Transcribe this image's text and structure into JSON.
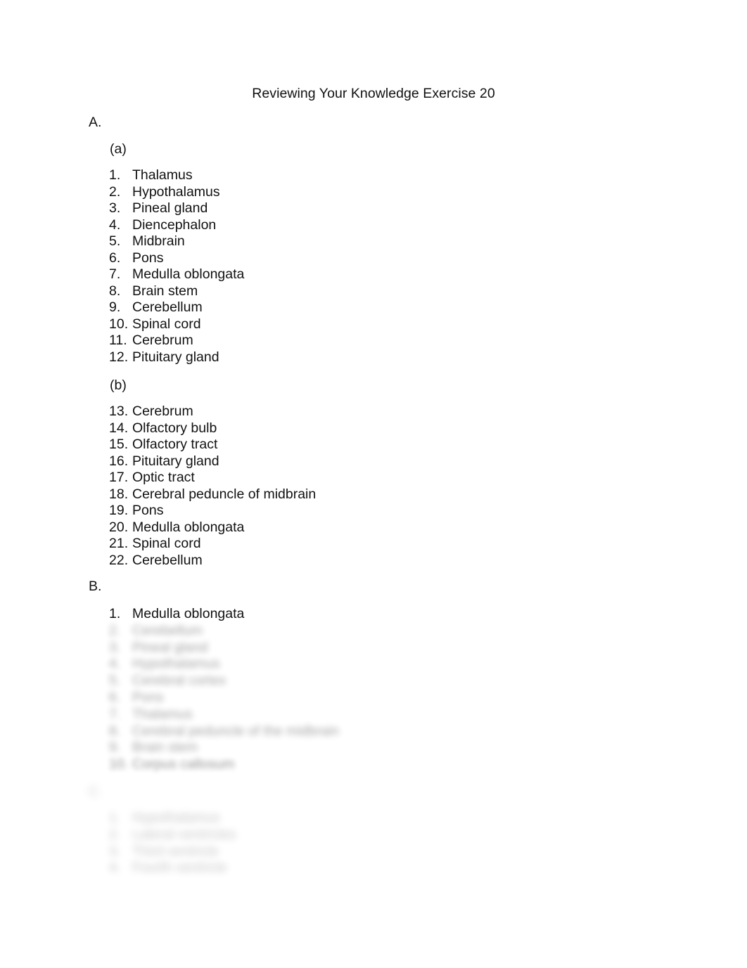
{
  "document": {
    "title": "Reviewing Your Knowledge Exercise 20",
    "background_color": "#ffffff",
    "text_color": "#111111"
  },
  "sections": [
    {
      "letter": "A.",
      "subsections": [
        {
          "label": "(a)",
          "items": [
            {
              "number": "1.",
              "text": "Thalamus"
            },
            {
              "number": "2.",
              "text": "Hypothalamus"
            },
            {
              "number": "3.",
              "text": "Pineal gland"
            },
            {
              "number": "4.",
              "text": "Diencephalon"
            },
            {
              "number": "5.",
              "text": "Midbrain"
            },
            {
              "number": "6.",
              "text": "Pons"
            },
            {
              "number": "7.",
              "text": "Medulla oblongata"
            },
            {
              "number": "8.",
              "text": "Brain stem"
            },
            {
              "number": "9.",
              "text": "Cerebellum"
            },
            {
              "number": "10.",
              "text": "Spinal cord"
            },
            {
              "number": "11.",
              "text": "Cerebrum"
            },
            {
              "number": "12.",
              "text": "Pituitary gland"
            }
          ]
        },
        {
          "label": "(b)",
          "items": [
            {
              "number": "13.",
              "text": "Cerebrum"
            },
            {
              "number": "14.",
              "text": "Olfactory bulb"
            },
            {
              "number": "15.",
              "text": "Olfactory tract"
            },
            {
              "number": "16.",
              "text": "Pituitary gland"
            },
            {
              "number": "17.",
              "text": "Optic tract"
            },
            {
              "number": "18.",
              "text": "Cerebral peduncle of midbrain"
            },
            {
              "number": "19.",
              "text": "Pons"
            },
            {
              "number": "20.",
              "text": "Medulla oblongata"
            },
            {
              "number": "21.",
              "text": "Spinal cord"
            },
            {
              "number": "22.",
              "text": "Cerebellum"
            }
          ]
        }
      ]
    },
    {
      "letter": "B.",
      "subsections": [
        {
          "label": "",
          "items": [
            {
              "number": "1.",
              "text": "Medulla oblongata"
            },
            {
              "number": "2.",
              "text": "Cerebellum"
            },
            {
              "number": "3.",
              "text": "Pineal gland"
            },
            {
              "number": "4.",
              "text": "Hypothalamus"
            },
            {
              "number": "5.",
              "text": "Cerebral cortex"
            },
            {
              "number": "6.",
              "text": "Pons"
            },
            {
              "number": "7.",
              "text": "Thalamus"
            },
            {
              "number": "8.",
              "text": "Cerebral peduncle of the midbrain"
            },
            {
              "number": "9.",
              "text": "Brain stem"
            },
            {
              "number": "10.",
              "text": "Corpus callosum"
            }
          ]
        }
      ]
    },
    {
      "letter": "C.",
      "subsections": [
        {
          "label": "",
          "items": [
            {
              "number": "1.",
              "text": "Hypothalamus"
            },
            {
              "number": "2.",
              "text": "Lateral ventricles"
            },
            {
              "number": "3.",
              "text": "Third ventricle"
            },
            {
              "number": "4.",
              "text": "Fourth ventricle"
            }
          ]
        }
      ]
    }
  ]
}
